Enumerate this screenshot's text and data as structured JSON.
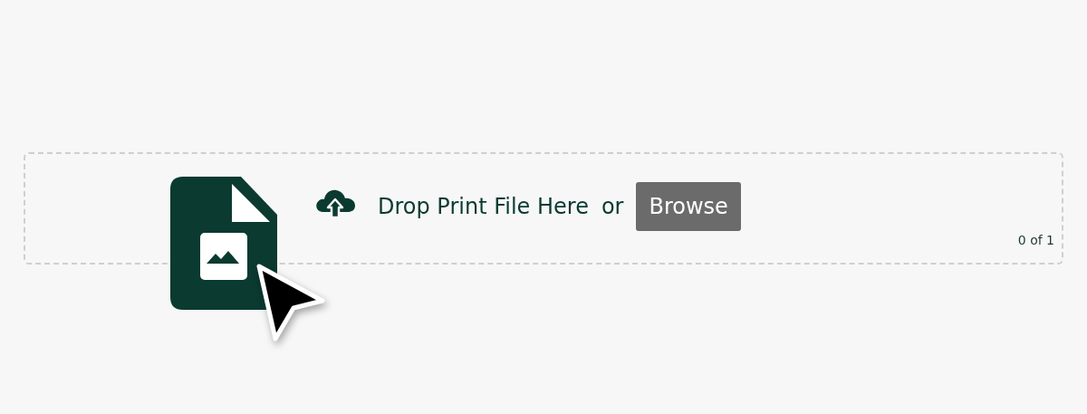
{
  "dropzone": {
    "prompt": "Drop Print File Here",
    "separator": "or",
    "browse_button": "Browse",
    "counter": "0 of 1"
  }
}
